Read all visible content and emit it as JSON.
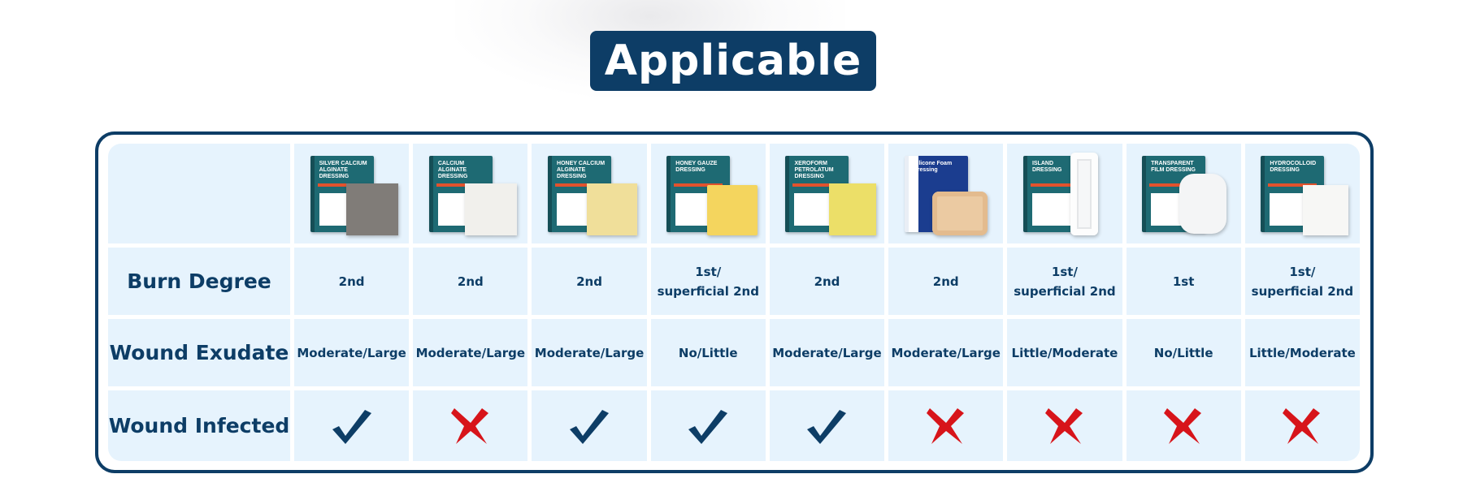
{
  "title": "Applicable",
  "row_labels": {
    "burn_degree": "Burn Degree",
    "wound_exudate": "Wound Exudate",
    "wound_infected": "Wound Infected"
  },
  "colors": {
    "primary": "#0d3d66",
    "cell_bg": "#e6f3fd",
    "check": "#0d3d66",
    "cross": "#d7141a"
  },
  "products": [
    {
      "name": "SILVER CALCIUM ALGINATE DRESSING",
      "box_style": "teal",
      "pad_color": "#807c78",
      "burn_degree": [
        "2nd"
      ],
      "wound_exudate": "Moderate/Large",
      "wound_infected": true,
      "infected_icon": "check-icon"
    },
    {
      "name": "CALCIUM ALGINATE DRESSING",
      "box_style": "teal",
      "pad_color": "#f1f0ec",
      "burn_degree": [
        "2nd"
      ],
      "wound_exudate": "Moderate/Large",
      "wound_infected": false,
      "infected_icon": "cross-icon"
    },
    {
      "name": "HONEY CALCIUM ALGINATE DRESSING",
      "box_style": "teal",
      "pad_color": "#f0df9a",
      "burn_degree": [
        "2nd"
      ],
      "wound_exudate": "Moderate/Large",
      "wound_infected": true,
      "infected_icon": "check-icon"
    },
    {
      "name": "HONEY GAUZE DRESSING",
      "box_style": "teal",
      "pad_color": "#f4d55e",
      "burn_degree": [
        "1st/",
        "superficial 2nd"
      ],
      "wound_exudate": "No/Little",
      "wound_infected": true,
      "infected_icon": "check-icon"
    },
    {
      "name": "XEROFORM PETROLATUM DRESSING",
      "box_style": "teal",
      "pad_color": "#ecdf68",
      "burn_degree": [
        "2nd"
      ],
      "wound_exudate": "Moderate/Large",
      "wound_infected": true,
      "infected_icon": "check-icon"
    },
    {
      "name": "Silicone Foam Dressing",
      "box_style": "blue",
      "pad_color": "#ebcaa2",
      "burn_degree": [
        "2nd"
      ],
      "wound_exudate": "Moderate/Large",
      "wound_infected": false,
      "infected_icon": "cross-icon"
    },
    {
      "name": "ISLAND DRESSING",
      "box_style": "teal",
      "pad_color": "#f6f7f8",
      "burn_degree": [
        "1st/",
        "superficial 2nd"
      ],
      "wound_exudate": "Little/Moderate",
      "wound_infected": false,
      "infected_icon": "cross-icon"
    },
    {
      "name": "TRANSPARENT FILM DRESSING",
      "box_style": "teal",
      "pad_color": "#f4f5f6",
      "burn_degree": [
        "1st"
      ],
      "wound_exudate": "No/Little",
      "wound_infected": false,
      "infected_icon": "cross-icon"
    },
    {
      "name": "HYDROCOLLOID DRESSING",
      "box_style": "teal",
      "pad_color": "#f7f7f5",
      "burn_degree": [
        "1st/",
        "superficial 2nd"
      ],
      "wound_exudate": "Little/Moderate",
      "wound_infected": false,
      "infected_icon": "cross-icon"
    }
  ]
}
